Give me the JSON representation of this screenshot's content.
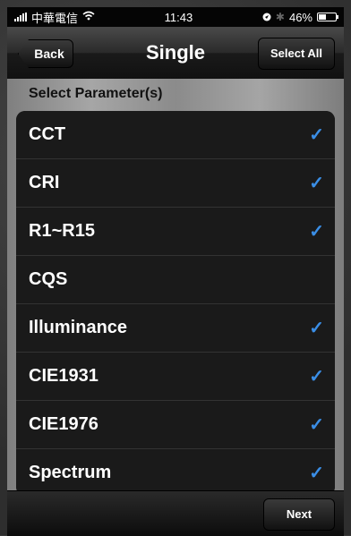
{
  "status_bar": {
    "carrier": "中華電信",
    "time": "11:43",
    "battery_percent": "46%",
    "battery_level": 0.46
  },
  "nav": {
    "title": "Single",
    "back_label": "Back",
    "select_all_label": "Select All"
  },
  "section_header": "Select Parameter(s)",
  "parameters": [
    {
      "label": "CCT",
      "checked": true
    },
    {
      "label": "CRI",
      "checked": true
    },
    {
      "label": "R1~R15",
      "checked": true
    },
    {
      "label": "CQS",
      "checked": false
    },
    {
      "label": "Illuminance",
      "checked": true
    },
    {
      "label": "CIE1931",
      "checked": true
    },
    {
      "label": "CIE1976",
      "checked": true
    },
    {
      "label": "Spectrum",
      "checked": true
    }
  ],
  "check_mark": "✓",
  "toolbar": {
    "next_label": "Next"
  },
  "colors": {
    "check": "#3a8ee6"
  },
  "icons": {
    "signal": "signal-icon",
    "wifi": "wifi-icon",
    "location": "location-icon",
    "bluetooth": "bluetooth-icon",
    "battery": "battery-icon"
  }
}
